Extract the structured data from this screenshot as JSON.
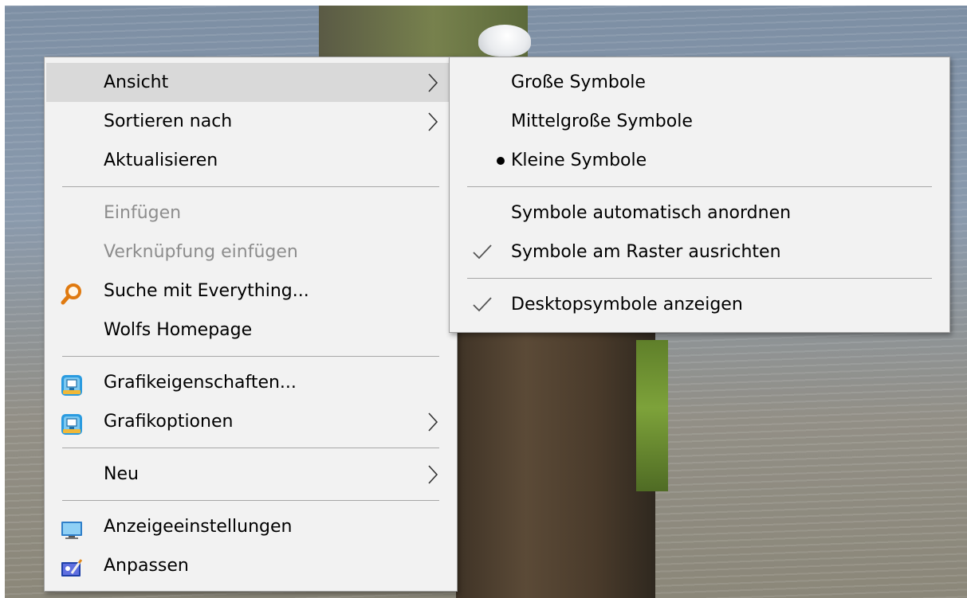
{
  "context_menu": {
    "groups": [
      [
        {
          "label": "Ansicht",
          "submenu": true,
          "highlighted": true,
          "icon": null
        },
        {
          "label": "Sortieren nach",
          "submenu": true,
          "icon": null
        },
        {
          "label": "Aktualisieren",
          "icon": null
        }
      ],
      [
        {
          "label": "Einfügen",
          "disabled": true,
          "icon": null
        },
        {
          "label": "Verknüpfung einfügen",
          "disabled": true,
          "icon": null
        },
        {
          "label": "Suche mit Everything...",
          "icon": "magnifier-icon"
        },
        {
          "label": "Wolfs Homepage",
          "icon": null
        }
      ],
      [
        {
          "label": "Grafikeigenschaften...",
          "icon": "graphics-properties-icon"
        },
        {
          "label": "Grafikoptionen",
          "submenu": true,
          "icon": "graphics-options-icon"
        }
      ],
      [
        {
          "label": "Neu",
          "submenu": true,
          "icon": null
        }
      ],
      [
        {
          "label": "Anzeigeeinstellungen",
          "icon": "display-settings-icon"
        },
        {
          "label": "Anpassen",
          "icon": "personalize-icon"
        }
      ]
    ]
  },
  "view_submenu": {
    "groups": [
      [
        {
          "label": "Große Symbole",
          "state": null
        },
        {
          "label": "Mittelgroße Symbole",
          "state": null
        },
        {
          "label": "Kleine Symbole",
          "state": "bullet"
        }
      ],
      [
        {
          "label": "Symbole automatisch anordnen",
          "state": null
        },
        {
          "label": "Symbole am Raster ausrichten",
          "state": "check"
        }
      ],
      [
        {
          "label": "Desktopsymbole anzeigen",
          "state": "check"
        }
      ]
    ]
  },
  "colors": {
    "menu_background": "#f2f2f2",
    "highlight": "#d9d9d9",
    "disabled_text": "#8d8d8d",
    "separator": "#a7a7a7",
    "search_icon_accent": "#e07a10",
    "graphics_icon_accent": "#1f8fd0"
  }
}
